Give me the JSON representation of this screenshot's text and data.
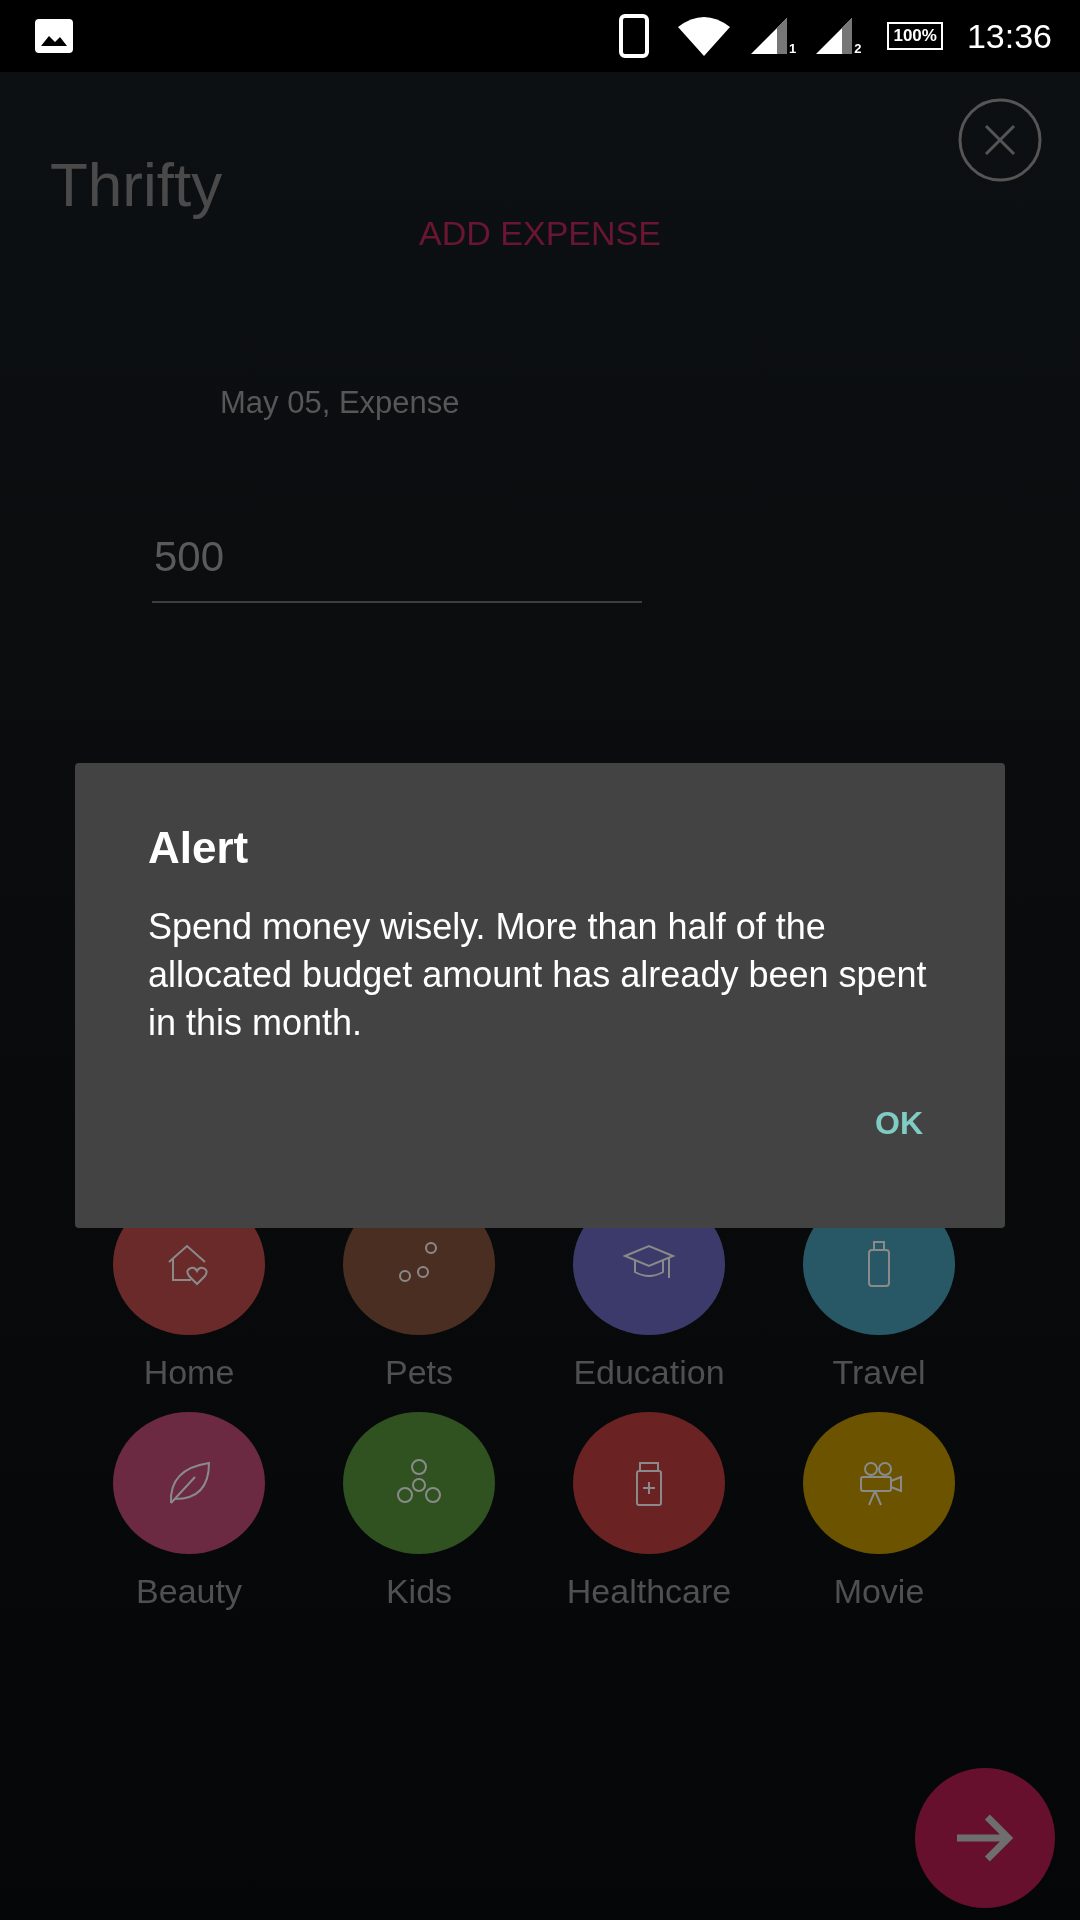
{
  "status_bar": {
    "battery": "100%",
    "time": "13:36",
    "sim_labels": [
      "1",
      "2"
    ]
  },
  "app": {
    "title": "Thrifty",
    "screen_title": "ADD EXPENSE",
    "date_label": "May 05, Expense",
    "amount": "500"
  },
  "categories": [
    {
      "label": "Home",
      "color": "#6b2a2a"
    },
    {
      "label": "Pets",
      "color": "#4b2e22"
    },
    {
      "label": "Education",
      "color": "#3b3a6b"
    },
    {
      "label": "Travel",
      "color": "#285866"
    },
    {
      "label": "Beauty",
      "color": "#6b2a42"
    },
    {
      "label": "Kids",
      "color": "#2f5220"
    },
    {
      "label": "Healthcare",
      "color": "#6b2222"
    },
    {
      "label": "Movie",
      "color": "#6b5300"
    }
  ],
  "dialog": {
    "title": "Alert",
    "message": "Spend money wisely. More than half of the allocated budget amount has already been spent in this month.",
    "buttons": [
      "OK"
    ]
  }
}
